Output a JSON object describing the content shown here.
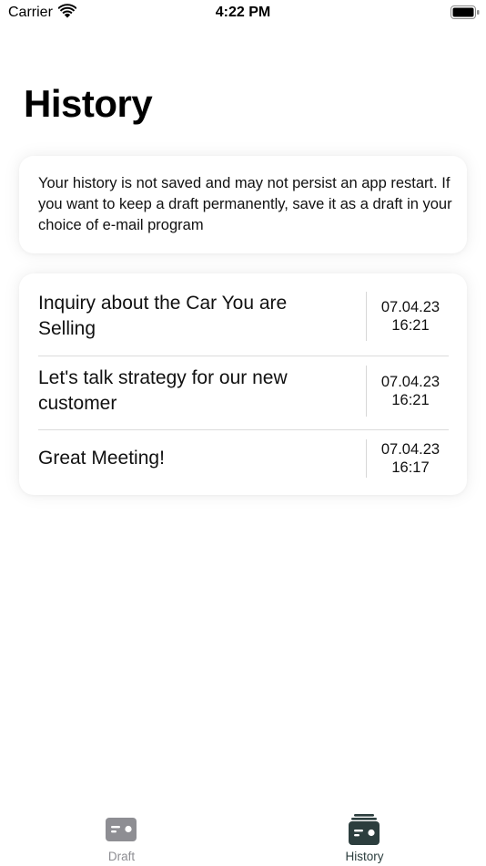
{
  "status_bar": {
    "carrier": "Carrier",
    "time": "4:22 PM"
  },
  "title": "History",
  "info_message": "Your history is not saved and may not persist an app restart. If you want to keep a draft permanently, save it as a draft in your choice of e-mail program",
  "history": [
    {
      "title": "Inquiry about the Car You are Selling",
      "date": "07.04.23",
      "time": "16:21"
    },
    {
      "title": "Let's talk strategy for our new customer",
      "date": "07.04.23",
      "time": "16:21"
    },
    {
      "title": "Great Meeting!",
      "date": "07.04.23",
      "time": "16:17"
    }
  ],
  "tabs": [
    {
      "label": "Draft",
      "icon": "draft-card-icon",
      "active": false
    },
    {
      "label": "History",
      "icon": "stacked-cards-icon",
      "active": true
    }
  ],
  "colors": {
    "active_tab": "#2c3e3e",
    "inactive_tab": "#8e8e93"
  }
}
